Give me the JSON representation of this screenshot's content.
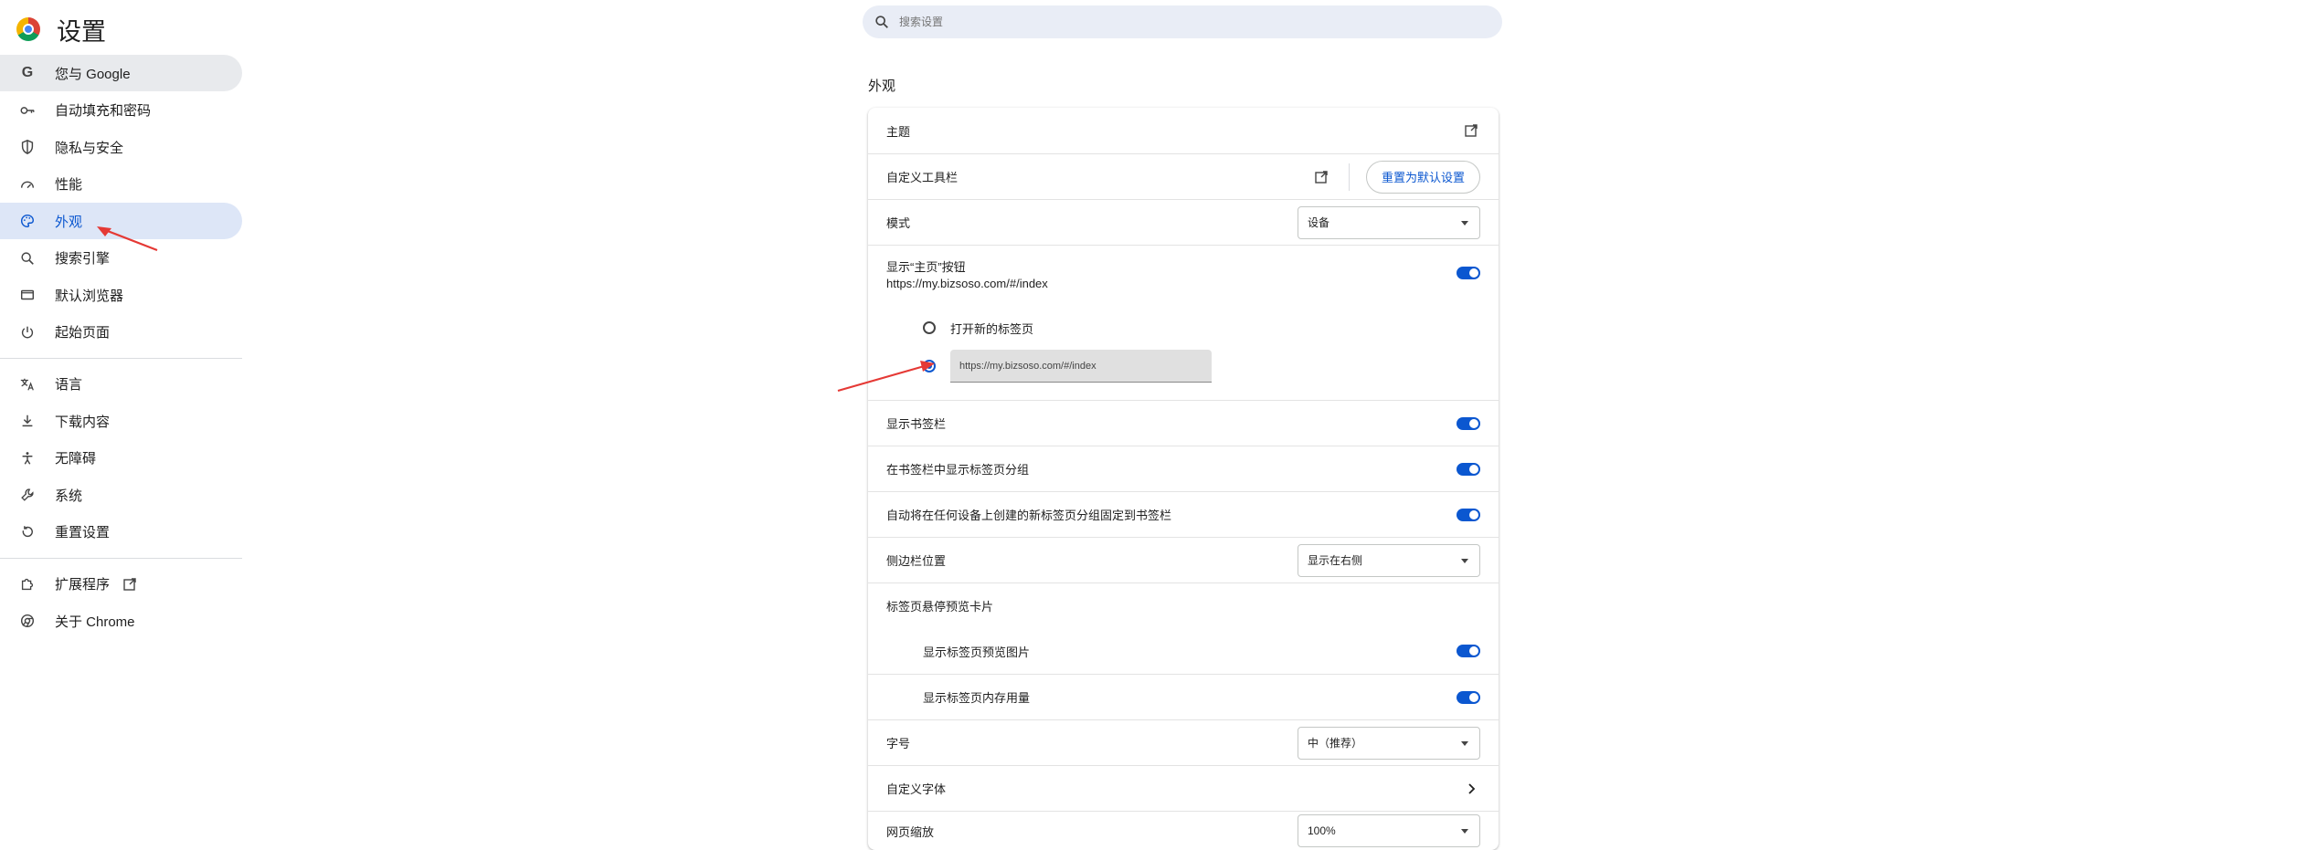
{
  "app": {
    "title": "设置"
  },
  "search": {
    "placeholder": "搜索设置"
  },
  "nav": {
    "items": [
      {
        "label": "您与 Google",
        "icon": "google-icon"
      },
      {
        "label": "自动填充和密码",
        "icon": "key-icon"
      },
      {
        "label": "隐私与安全",
        "icon": "shield-icon"
      },
      {
        "label": "性能",
        "icon": "speedometer-icon"
      },
      {
        "label": "外观",
        "icon": "palette-icon"
      },
      {
        "label": "搜索引擎",
        "icon": "search-icon"
      },
      {
        "label": "默认浏览器",
        "icon": "browser-window-icon"
      },
      {
        "label": "起始页面",
        "icon": "power-icon"
      },
      {
        "label": "语言",
        "icon": "translate-icon"
      },
      {
        "label": "下载内容",
        "icon": "download-icon"
      },
      {
        "label": "无障碍",
        "icon": "accessibility-icon"
      },
      {
        "label": "系统",
        "icon": "wrench-icon"
      },
      {
        "label": "重置设置",
        "icon": "reset-icon"
      },
      {
        "label": "扩展程序",
        "icon": "puzzle-icon"
      },
      {
        "label": "关于 Chrome",
        "icon": "chrome-icon"
      }
    ]
  },
  "section": {
    "title": "外观"
  },
  "appearance": {
    "theme_label": "主题",
    "toolbar_label": "自定义工具栏",
    "reset_button": "重置为默认设置",
    "mode_label": "模式",
    "mode_value": "设备",
    "home_label": "显示“主页”按钮",
    "home_url": "https://my.bizsoso.com/#/index",
    "radio_newtab": "打开新的标签页",
    "radio_url_value": "https://my.bizsoso.com/#/index",
    "bookmarks_label": "显示书签栏",
    "tab_groups_label": "在书签栏中显示标签页分组",
    "pin_groups_label": "自动将在任何设备上创建的新标签页分组固定到书签栏",
    "sidebar_label": "侧边栏位置",
    "sidebar_value": "显示在右侧",
    "hover_label": "标签页悬停预览卡片",
    "hover_image_label": "显示标签页预览图片",
    "hover_memory_label": "显示标签页内存用量",
    "font_size_label": "字号",
    "font_size_value": "中（推荐）",
    "custom_font_label": "自定义字体",
    "zoom_label": "网页缩放",
    "zoom_value": "100%"
  },
  "colors": {
    "accent": "#0b57d0",
    "arrow": "#e53935",
    "nav_active": "#e8eaed",
    "nav_highlight": "#dde6f7"
  }
}
